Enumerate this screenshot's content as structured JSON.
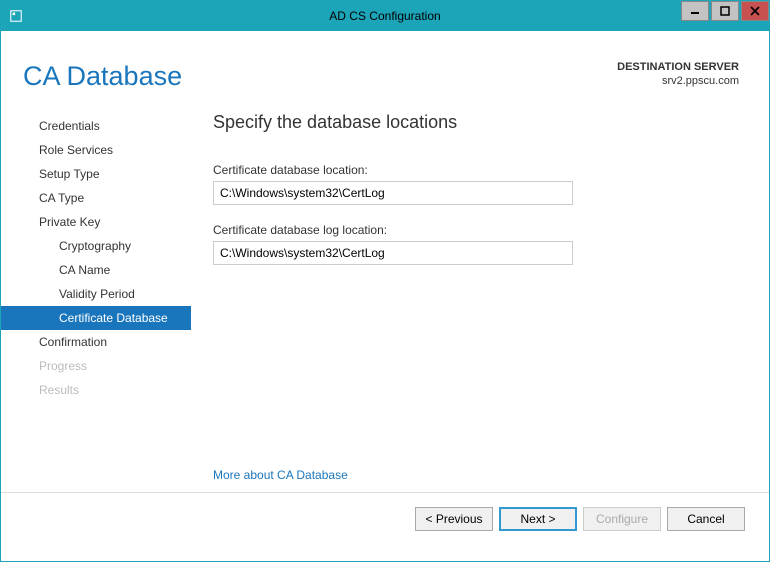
{
  "window": {
    "title": "AD CS Configuration"
  },
  "header": {
    "page_title": "CA Database",
    "dest_label": "DESTINATION SERVER",
    "dest_server": "srv2.ppscu.com"
  },
  "sidebar": {
    "items": [
      {
        "label": "Credentials",
        "sub": false,
        "active": false,
        "disabled": false
      },
      {
        "label": "Role Services",
        "sub": false,
        "active": false,
        "disabled": false
      },
      {
        "label": "Setup Type",
        "sub": false,
        "active": false,
        "disabled": false
      },
      {
        "label": "CA Type",
        "sub": false,
        "active": false,
        "disabled": false
      },
      {
        "label": "Private Key",
        "sub": false,
        "active": false,
        "disabled": false
      },
      {
        "label": "Cryptography",
        "sub": true,
        "active": false,
        "disabled": false
      },
      {
        "label": "CA Name",
        "sub": true,
        "active": false,
        "disabled": false
      },
      {
        "label": "Validity Period",
        "sub": true,
        "active": false,
        "disabled": false
      },
      {
        "label": "Certificate Database",
        "sub": true,
        "active": true,
        "disabled": false
      },
      {
        "label": "Confirmation",
        "sub": false,
        "active": false,
        "disabled": false
      },
      {
        "label": "Progress",
        "sub": false,
        "active": false,
        "disabled": true
      },
      {
        "label": "Results",
        "sub": false,
        "active": false,
        "disabled": true
      }
    ]
  },
  "main": {
    "heading": "Specify the database locations",
    "db_label": "Certificate database location:",
    "db_value": "C:\\Windows\\system32\\CertLog",
    "log_label": "Certificate database log location:",
    "log_value": "C:\\Windows\\system32\\CertLog",
    "more_link": "More about CA Database"
  },
  "footer": {
    "previous": "< Previous",
    "next": "Next >",
    "configure": "Configure",
    "cancel": "Cancel"
  }
}
